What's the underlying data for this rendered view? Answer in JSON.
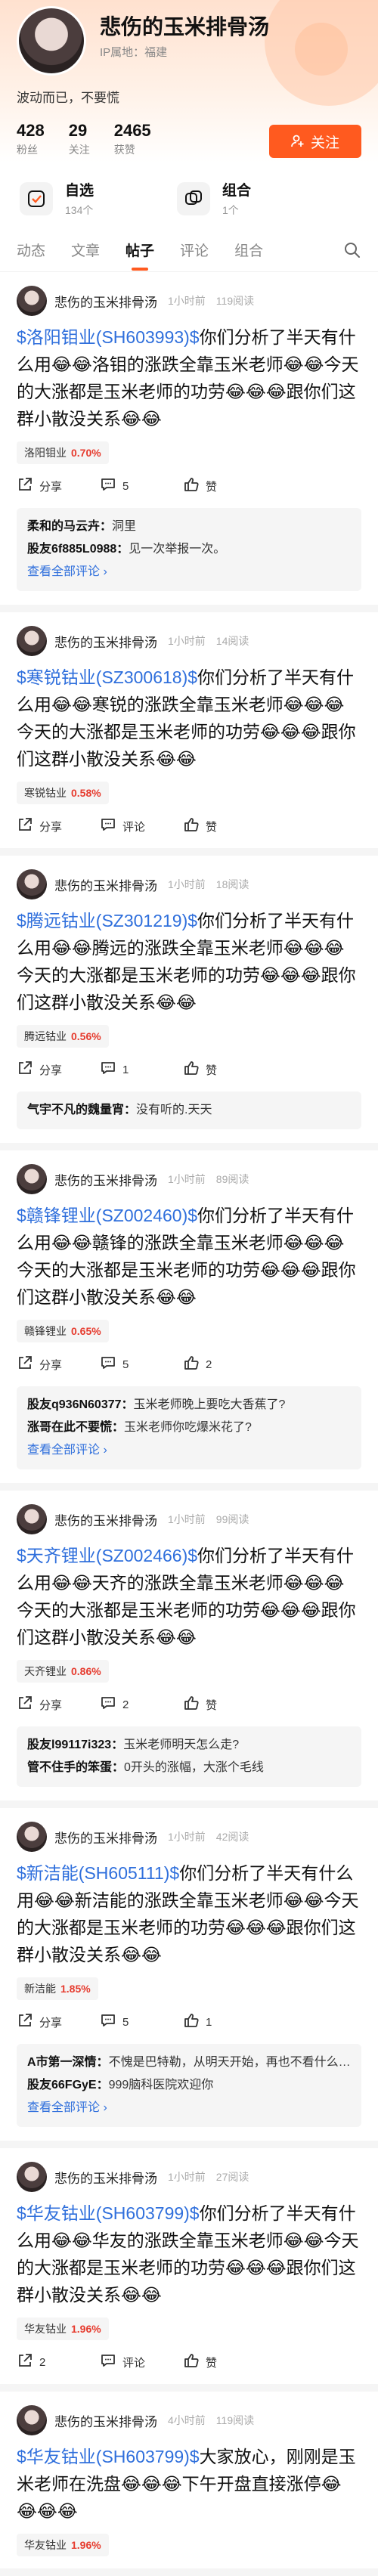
{
  "profile": {
    "username": "悲伤的玉米排骨汤",
    "ip": "IP属地：福建",
    "bio": "波动而已，不要慌",
    "stats": [
      {
        "num": "428",
        "label": "粉丝"
      },
      {
        "num": "29",
        "label": "关注"
      },
      {
        "num": "2465",
        "label": "获赞"
      }
    ],
    "follow_label": "关注"
  },
  "cards": [
    {
      "title": "自选",
      "sub": "134个",
      "icon": "star-check-icon"
    },
    {
      "title": "组合",
      "sub": "1个",
      "icon": "portfolio-icon"
    }
  ],
  "tabs": [
    "动态",
    "文章",
    "帖子",
    "评论",
    "组合"
  ],
  "active_tab": "帖子",
  "accent": "#ff5a1f",
  "posts": [
    {
      "author": "悲伤的玉米排骨汤",
      "time": "1小时前",
      "reads": "119阅读",
      "stock": "$洛阳钼业(SH603993)$",
      "text": "你们分析了半天有什么用😂😂洛钼的涨跌全靠玉米老师😂😂今天的大涨都是玉米老师的功劳😂😂😂跟你们这群小散没关系😂😂",
      "tag": "洛阳钼业",
      "chg": "0.70%",
      "share": "分享",
      "comment_count": "5",
      "like": "赞",
      "comments": [
        {
          "user": "柔和的马云卉：",
          "text": "洞里"
        },
        {
          "user": "股友6f885L0988：",
          "text": "见一次举报一次。"
        }
      ],
      "more": "查看全部评论 ›"
    },
    {
      "author": "悲伤的玉米排骨汤",
      "time": "1小时前",
      "reads": "14阅读",
      "stock": "$寒锐钴业(SZ300618)$",
      "text": "你们分析了半天有什么用😂😂寒锐的涨跌全靠玉米老师😂😂😂今天的大涨都是玉米老师的功劳😂😂😂跟你们这群小散没关系😂😂",
      "tag": "寒锐钴业",
      "chg": "0.58%",
      "share": "分享",
      "comment_count": "评论",
      "like": "赞",
      "comments": [],
      "more": ""
    },
    {
      "author": "悲伤的玉米排骨汤",
      "time": "1小时前",
      "reads": "18阅读",
      "stock": "$腾远钴业(SZ301219)$",
      "text": "你们分析了半天有什么用😂😂腾远的涨跌全靠玉米老师😂😂😂今天的大涨都是玉米老师的功劳😂😂😂跟你们这群小散没关系😂😂",
      "tag": "腾远钴业",
      "chg": "0.56%",
      "share": "分享",
      "comment_count": "1",
      "like": "赞",
      "comments": [
        {
          "user": "气宇不凡的魏量宵：",
          "text": "没有听的.天天"
        }
      ],
      "more": ""
    },
    {
      "author": "悲伤的玉米排骨汤",
      "time": "1小时前",
      "reads": "89阅读",
      "stock": "$赣锋锂业(SZ002460)$",
      "text": "你们分析了半天有什么用😂😂赣锋的涨跌全靠玉米老师😂😂😂今天的大涨都是玉米老师的功劳😂😂😂跟你们这群小散没关系😂😂",
      "tag": "赣锋锂业",
      "chg": "0.65%",
      "share": "分享",
      "comment_count": "5",
      "like": "2",
      "comments": [
        {
          "user": "股友q936N60377：",
          "text": "玉米老师晚上要吃大香蕉了?"
        },
        {
          "user": "涨哥在此不要慌：",
          "text": "玉米老师你吃爆米花了?"
        }
      ],
      "more": "查看全部评论 ›"
    },
    {
      "author": "悲伤的玉米排骨汤",
      "time": "1小时前",
      "reads": "99阅读",
      "stock": "$天齐锂业(SZ002466)$",
      "text": "你们分析了半天有什么用😂😂天齐的涨跌全靠玉米老师😂😂😂今天的大涨都是玉米老师的功劳😂😂😂跟你们这群小散没关系😂😂",
      "tag": "天齐锂业",
      "chg": "0.86%",
      "share": "分享",
      "comment_count": "2",
      "like": "赞",
      "comments": [
        {
          "user": "股友l99117i323：",
          "text": "玉米老师明天怎么走?"
        },
        {
          "user": "管不住手的笨蛋：",
          "text": "0开头的涨幅，大涨个毛线"
        }
      ],
      "more": ""
    },
    {
      "author": "悲伤的玉米排骨汤",
      "time": "1小时前",
      "reads": "42阅读",
      "stock": "$新洁能(SH605111)$",
      "text": "你们分析了半天有什么用😂😂新洁能的涨跌全靠玉米老师😂😂今天的大涨都是玉米老师的功劳😂😂😂跟你们这群小散没关系😂😂",
      "tag": "新洁能",
      "chg": "1.85%",
      "share": "分享",
      "comment_count": "5",
      "like": "1",
      "comments": [
        {
          "user": "A市第一深情：",
          "text": "不愧是巴特勒，从明天开始，再也不看什么分析帖了，跟好巴特勒老师的节奏.做..."
        },
        {
          "user": "股友66FGyE：",
          "text": "999脑科医院欢迎你"
        }
      ],
      "more": "查看全部评论 ›"
    },
    {
      "author": "悲伤的玉米排骨汤",
      "time": "1小时前",
      "reads": "27阅读",
      "stock": "$华友钴业(SH603799)$",
      "text": "你们分析了半天有什么用😂😂华友的涨跌全靠玉米老师😂😂今天的大涨都是玉米老师的功劳😂😂😂跟你们这群小散没关系😂😂",
      "tag": "华友钴业",
      "chg": "1.96%",
      "share": "2",
      "comment_count": "评论",
      "like": "赞",
      "comments": [],
      "more": ""
    },
    {
      "author": "悲伤的玉米排骨汤",
      "time": "4小时前",
      "reads": "119阅读",
      "stock": "$华友钴业(SH603799)$",
      "text": "大家放心，刚刚是玉米老师在洗盘😂😂😂下午开盘直接涨停😂😂😂😂",
      "tag": "华友钴业",
      "chg": "1.96%",
      "share": "",
      "comment_count": "",
      "like": "",
      "comments": [],
      "more": ""
    }
  ]
}
